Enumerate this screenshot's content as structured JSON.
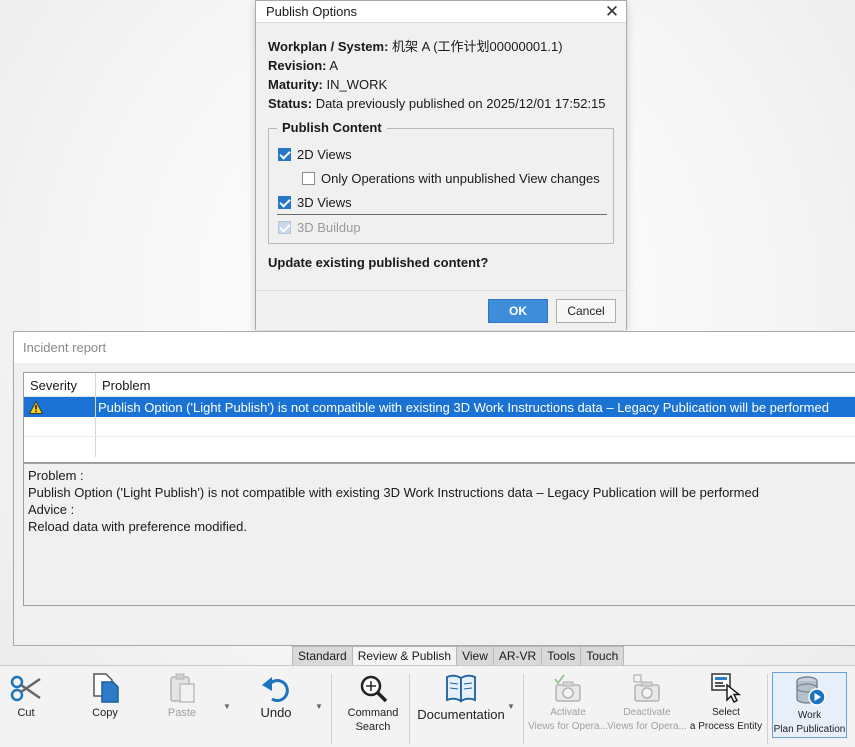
{
  "publish_dialog": {
    "title": "Publish Options",
    "close_glyph": "✕",
    "workplan_key": "Workplan / System:",
    "workplan_value": "机架 A (工作计划00000001.1)",
    "revision_key": "Revision:",
    "revision_value": "A",
    "maturity_key": "Maturity:",
    "maturity_value": "IN_WORK",
    "status_key": "Status:",
    "status_value": "Data previously published on 2025/12/01 17:52:15",
    "group_title": "Publish Content",
    "options": {
      "views_2d": {
        "label": "2D Views",
        "checked": true
      },
      "only_ops": {
        "label": "Only Operations with unpublished View changes",
        "checked": false
      },
      "views_3d": {
        "label": "3D Views",
        "checked": true
      },
      "buildup_3d": {
        "label": "3D Buildup",
        "checked": true,
        "disabled": true
      }
    },
    "question": "Update existing published content?",
    "ok_label": "OK",
    "cancel_label": "Cancel"
  },
  "incident_report": {
    "title": "Incident report",
    "columns": {
      "severity": "Severity",
      "problem": "Problem"
    },
    "rows": [
      {
        "severity_icon": "warning-icon",
        "problem": "Publish Option ('Light Publish') is not compatible with existing 3D Work Instructions data – Legacy Publication will be performed"
      }
    ],
    "detail": {
      "problem_label": "Problem :",
      "problem_text": "Publish Option ('Light Publish') is not compatible with existing 3D Work Instructions data – Legacy Publication will be performed",
      "advice_label": "Advice :",
      "advice_text": "Reload data with preference modified."
    }
  },
  "ribbon": {
    "tabs": [
      "Standard",
      "Review & Publish",
      "View",
      "AR-VR",
      "Tools",
      "Touch"
    ],
    "active_tab": "Review & Publish",
    "buttons": {
      "cut": "Cut",
      "copy": "Copy",
      "paste": "Paste",
      "undo": "Undo",
      "command_search_1": "Command",
      "command_search_2": "Search",
      "documentation": "Documentation",
      "activate_1": "Activate",
      "activate_2": "Views for Opera...",
      "deactivate_1": "Deactivate",
      "deactivate_2": "Views for Opera...",
      "select_1": "Select",
      "select_2": "a Process Entity",
      "work_1": "Work",
      "work_2": "Plan Publication"
    }
  },
  "colors": {
    "selection_blue": "#1a73d4",
    "ok_button": "#3d8ddb",
    "checkbox_blue": "#2677c9",
    "warning_yellow": "#f7d21e"
  }
}
